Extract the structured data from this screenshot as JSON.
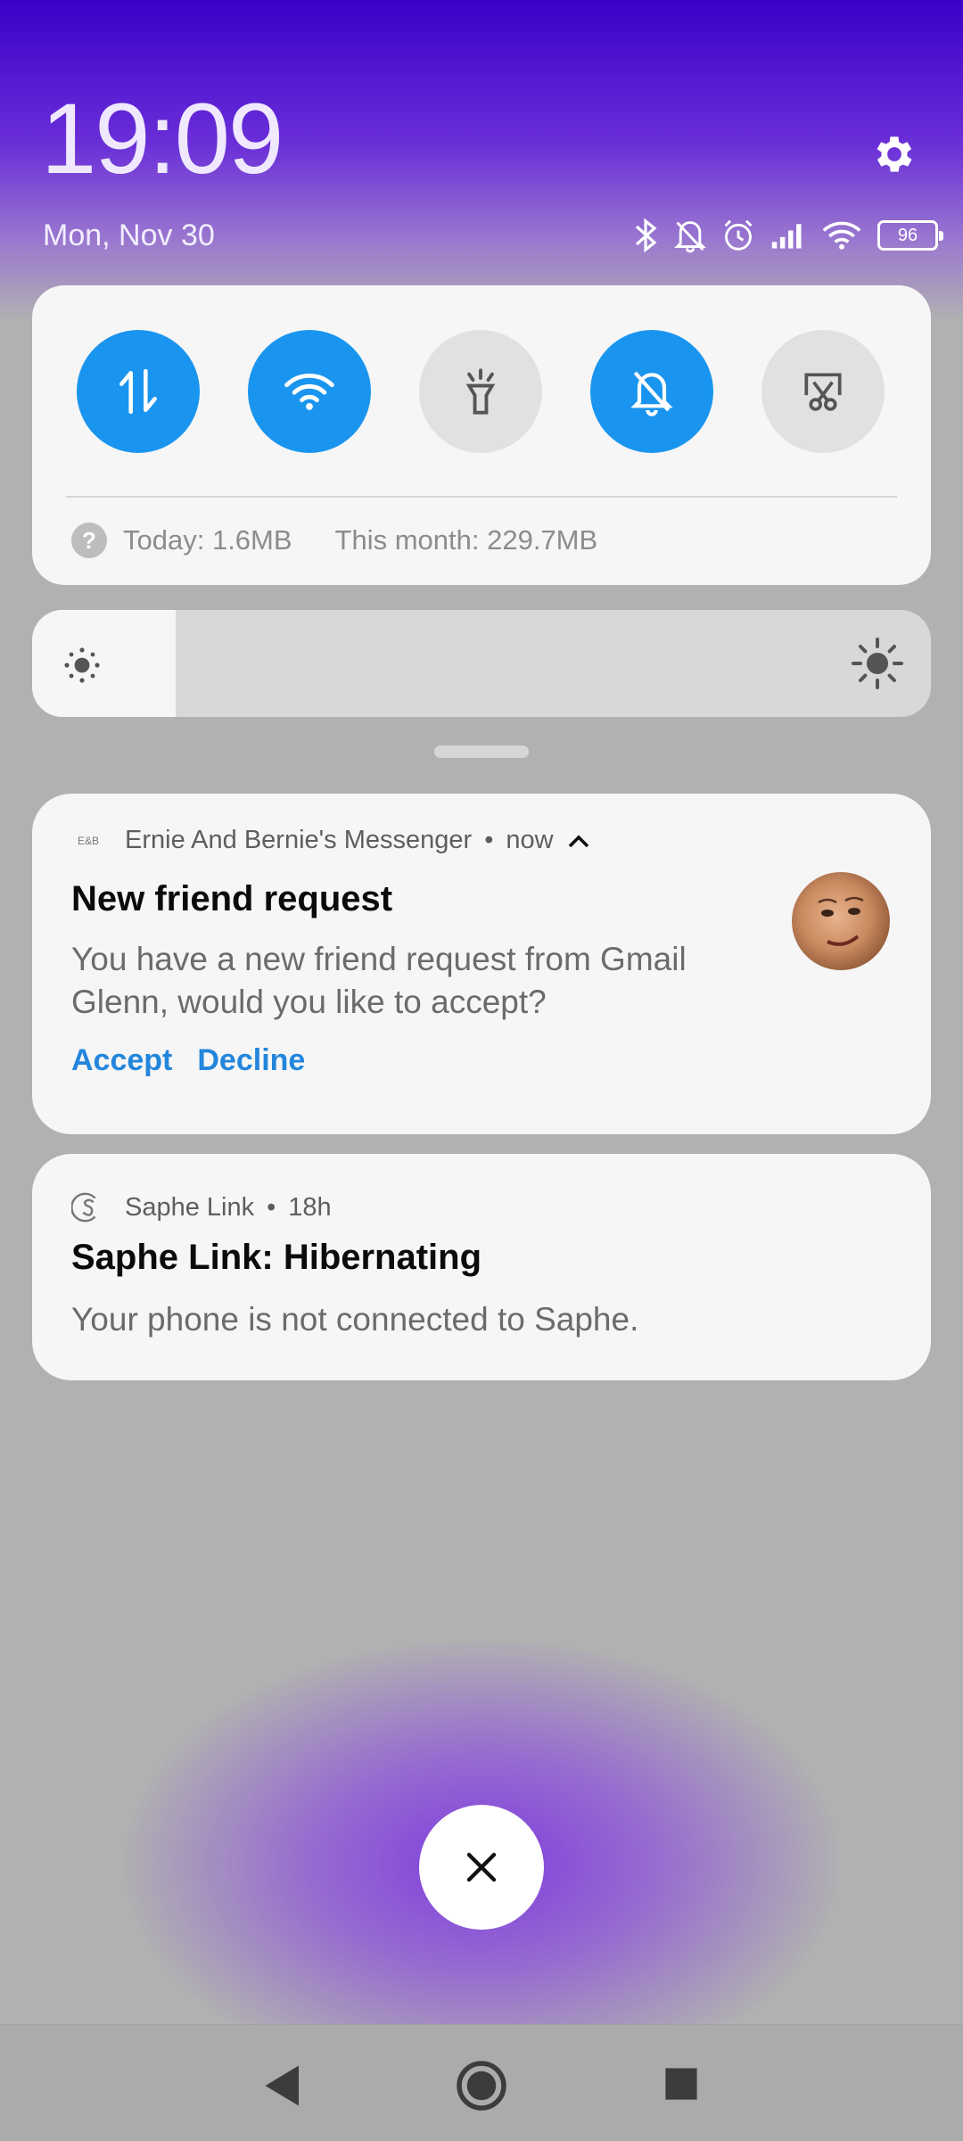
{
  "status": {
    "time": "19:09",
    "date": "Mon, Nov 30",
    "battery": "96",
    "icons": [
      "bluetooth-icon",
      "mute-icon",
      "alarm-icon",
      "signal-icon",
      "wifi-icon",
      "battery-icon"
    ]
  },
  "settings_icon": "gear-icon",
  "quick_settings": {
    "tiles": [
      {
        "name": "mobile-data",
        "icon": "data-arrows-icon",
        "state": "on"
      },
      {
        "name": "wifi",
        "icon": "wifi-icon",
        "state": "on"
      },
      {
        "name": "flashlight",
        "icon": "flashlight-icon",
        "state": "off"
      },
      {
        "name": "mute",
        "icon": "bell-off-icon",
        "state": "on"
      },
      {
        "name": "screenshot",
        "icon": "scissors-screen-icon",
        "state": "off"
      }
    ],
    "usage_today": "Today: 1.6MB",
    "usage_month": "This month: 229.7MB",
    "help_glyph": "?"
  },
  "brightness": {
    "level": 0.16
  },
  "notifications": [
    {
      "app_badge": "E&B",
      "app": "Ernie And Bernie's Messenger",
      "sep": "•",
      "time": "now",
      "title": "New friend request",
      "body": "You have a new friend request from Gmail Glenn, would you like to accept?",
      "actions": [
        "Accept",
        "Decline"
      ]
    },
    {
      "app": "Saphe Link",
      "sep": "•",
      "time": "18h",
      "title": "Saphe Link: Hibernating",
      "body": "Your phone is not connected to Saphe."
    }
  ],
  "colors": {
    "accent": "#1a95ef",
    "action": "#2386dc",
    "top": "#3a00c8"
  }
}
